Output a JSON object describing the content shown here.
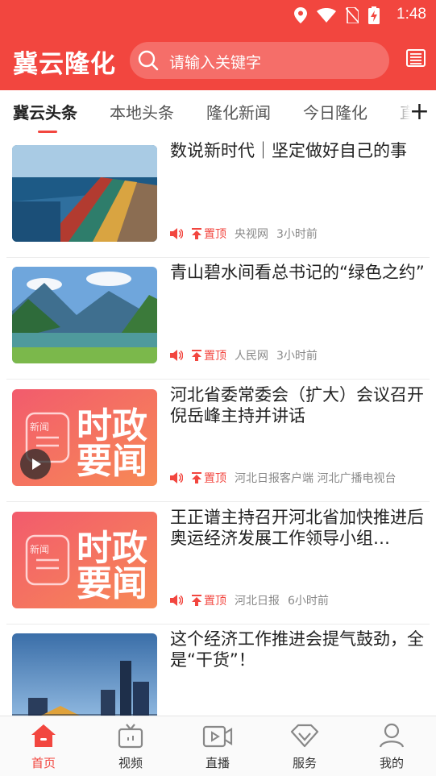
{
  "status_bar": {
    "time": "1:48"
  },
  "header": {
    "brand": "冀云隆化",
    "search_placeholder": "请输入关键字"
  },
  "tabs": [
    {
      "label": "冀云头条"
    },
    {
      "label": "本地头条"
    },
    {
      "label": "隆化新闻"
    },
    {
      "label": "今日隆化"
    },
    {
      "label": "直"
    }
  ],
  "pin_label": "置顶",
  "thumb_text": {
    "line1": "时政",
    "line2": "要闻",
    "badge": "新闻"
  },
  "articles": [
    {
      "title": "数说新时代｜坚定做好自己的事",
      "source": "央视网",
      "time": "3小时前"
    },
    {
      "title": "青山碧水间看总书记的“绿色之约”",
      "source": "人民网",
      "time": "3小时前"
    },
    {
      "title": "河北省委常委会（扩大）会议召开 倪岳峰主持并讲话",
      "source": "河北日报客户端 河北广播电视台",
      "time": ""
    },
    {
      "title": "王正谱主持召开河北省加快推进后奥运经济发展工作领导小组…",
      "source": "河北日报",
      "time": "6小时前"
    },
    {
      "title": "这个经济工作推进会提气鼓劲，全是“干货”！",
      "source": "",
      "time": ""
    }
  ],
  "bottom_nav": [
    {
      "label": "首页",
      "icon": "home-icon"
    },
    {
      "label": "视频",
      "icon": "tv-icon"
    },
    {
      "label": "直播",
      "icon": "live-video-icon"
    },
    {
      "label": "服务",
      "icon": "diamond-icon"
    },
    {
      "label": "我的",
      "icon": "user-icon"
    }
  ],
  "colors": {
    "brand_red": "#f2463f",
    "text": "#222222",
    "meta": "#888888"
  }
}
